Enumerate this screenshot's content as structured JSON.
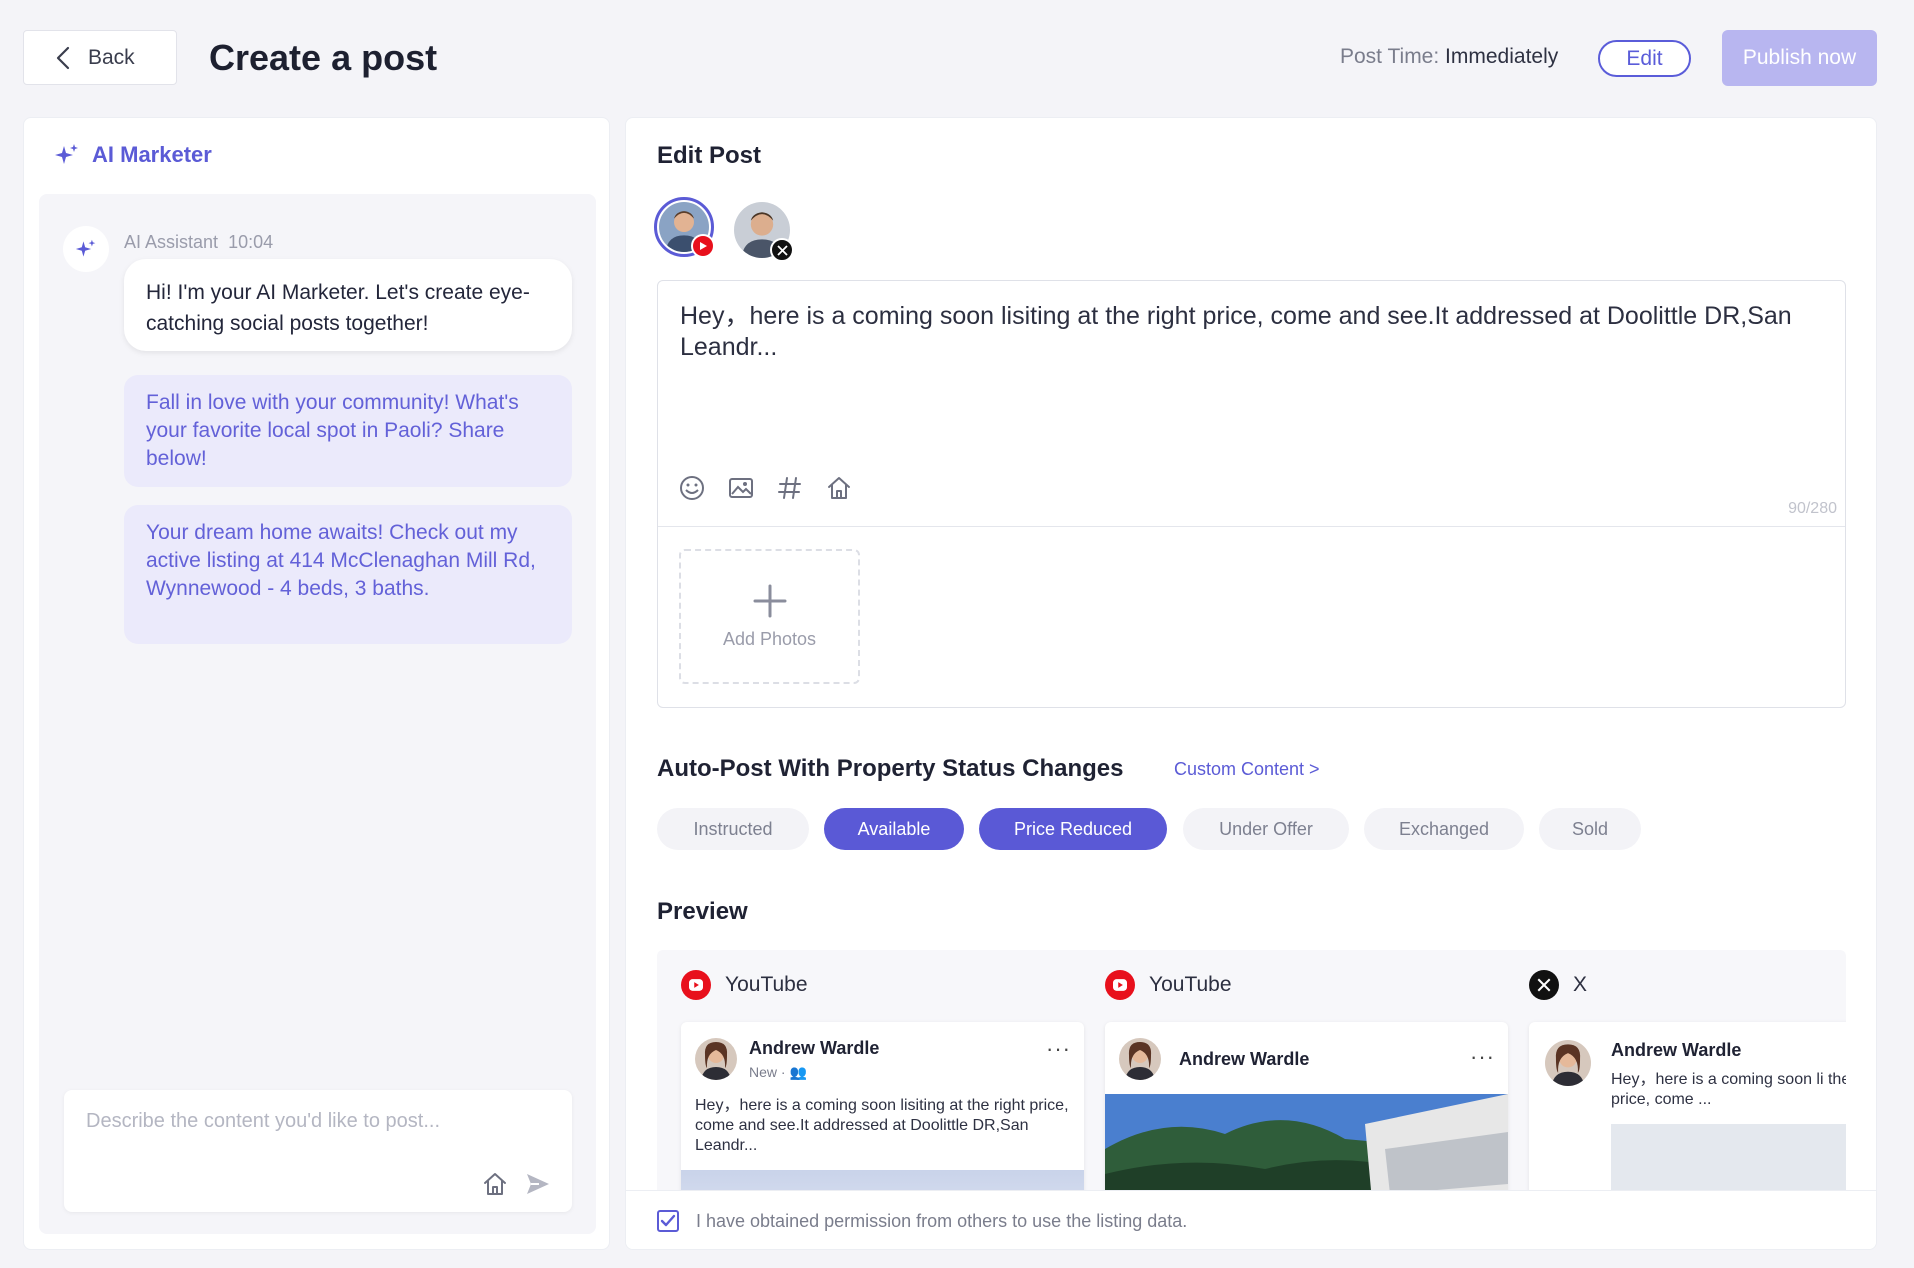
{
  "header": {
    "back_label": "Back",
    "title": "Create a post",
    "post_time_label": "Post Time:",
    "post_time_value": "Immediately",
    "edit_label": "Edit",
    "publish_label": "Publish now"
  },
  "ai_panel": {
    "title": "AI Marketer",
    "assistant_name": "AI Assistant",
    "assistant_time": "10:04",
    "greeting": "Hi! I'm your AI Marketer. Let's create eye-catching social posts together!",
    "suggestions": [
      "Fall in love with your community! What's your favorite local spot in Paoli? Share below!",
      "Your dream home awaits! Check out my active listing at 414 McClenaghan Mill Rd, Wynnewood - 4 beds, 3 baths."
    ],
    "input_placeholder": "Describe the content you'd like to post..."
  },
  "editor": {
    "title": "Edit Post",
    "accounts": [
      {
        "platform": "YouTube",
        "badge_icon": "youtube-icon",
        "selected": true
      },
      {
        "platform": "X",
        "badge_icon": "x-icon",
        "selected": false
      }
    ],
    "post_text": "Hey，here is a coming soon lisiting at the right price, come and see.It addressed at Doolittle DR,San Leandr...",
    "char_count": "90/280",
    "add_photos_label": "Add Photos"
  },
  "auto_post": {
    "title": "Auto-Post With Property Status Changes",
    "custom_link": "Custom Content >",
    "statuses": [
      {
        "label": "Instructed",
        "active": false
      },
      {
        "label": "Available",
        "active": true
      },
      {
        "label": "Price Reduced",
        "active": true
      },
      {
        "label": "Under Offer",
        "active": false
      },
      {
        "label": "Exchanged",
        "active": false
      },
      {
        "label": "Sold",
        "active": false
      }
    ]
  },
  "preview": {
    "title": "Preview",
    "columns": [
      {
        "platform": "YouTube",
        "author": "Andrew Wardle",
        "sub": "New",
        "text": "Hey，here is a coming soon lisiting at the right price, come and see.It addressed at Doolittle DR,San Leandr..."
      },
      {
        "platform": "YouTube",
        "author": "Andrew Wardle"
      },
      {
        "platform": "X",
        "author": "Andrew Wardle",
        "text": "Hey，here is a coming soon li the right price, come ..."
      }
    ]
  },
  "permission": {
    "checked": true,
    "text": "I have obtained permission from others to use the listing data."
  },
  "colors": {
    "accent": "#5a59d6",
    "accent_light": "#ebeafb",
    "publish_disabled": "#b8b6f0",
    "youtube_red": "#e8101c",
    "x_black": "#111111"
  }
}
